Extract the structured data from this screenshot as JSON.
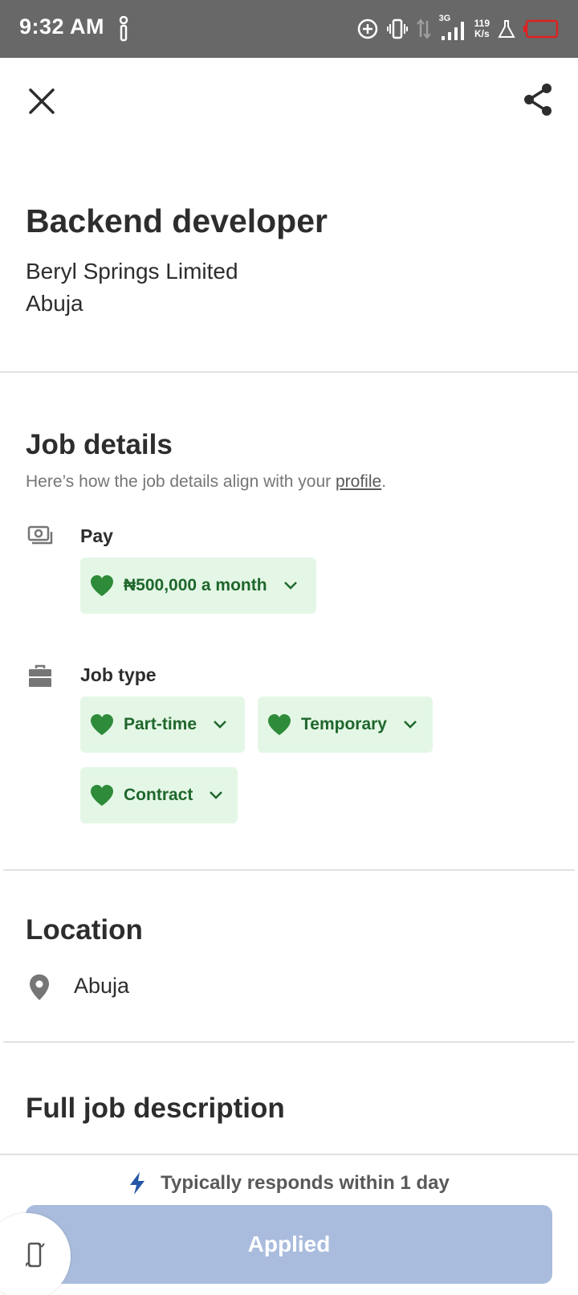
{
  "status_bar": {
    "time": "9:32 AM",
    "network_label": "3G",
    "speed_value": "119",
    "speed_unit": "K/s"
  },
  "job": {
    "title": "Backend developer",
    "company": "Beryl Springs Limited",
    "location": "Abuja"
  },
  "job_details": {
    "heading": "Job details",
    "subtext_prefix": "Here’s how the job details align with your ",
    "subtext_link": "profile",
    "subtext_suffix": ".",
    "pay_label": "Pay",
    "pay_value": "₦500,000 a month",
    "job_type_label": "Job type",
    "job_types": [
      "Part-time",
      "Temporary",
      "Contract"
    ]
  },
  "location_section": {
    "heading": "Location",
    "value": "Abuja"
  },
  "description_section": {
    "heading": "Full job description"
  },
  "bottom_bar": {
    "response_text": "Typically responds within 1 day",
    "applied_label": "Applied"
  },
  "colors": {
    "status_bar": "#686868",
    "chip_bg": "#e4f7e6",
    "chip_text": "#1f662c",
    "heart": "#2e8b3a",
    "applied_button": "#a9bcdd",
    "bolt": "#2557a7"
  },
  "icons": {
    "close": "close-icon",
    "share": "share-icon",
    "pay": "money-icon",
    "job_type": "briefcase-icon",
    "location": "location-pin-icon",
    "heart": "heart-icon",
    "chevron": "chevron-down-icon",
    "bolt": "lightning-bolt-icon",
    "rotate": "rotate-screen-icon"
  }
}
